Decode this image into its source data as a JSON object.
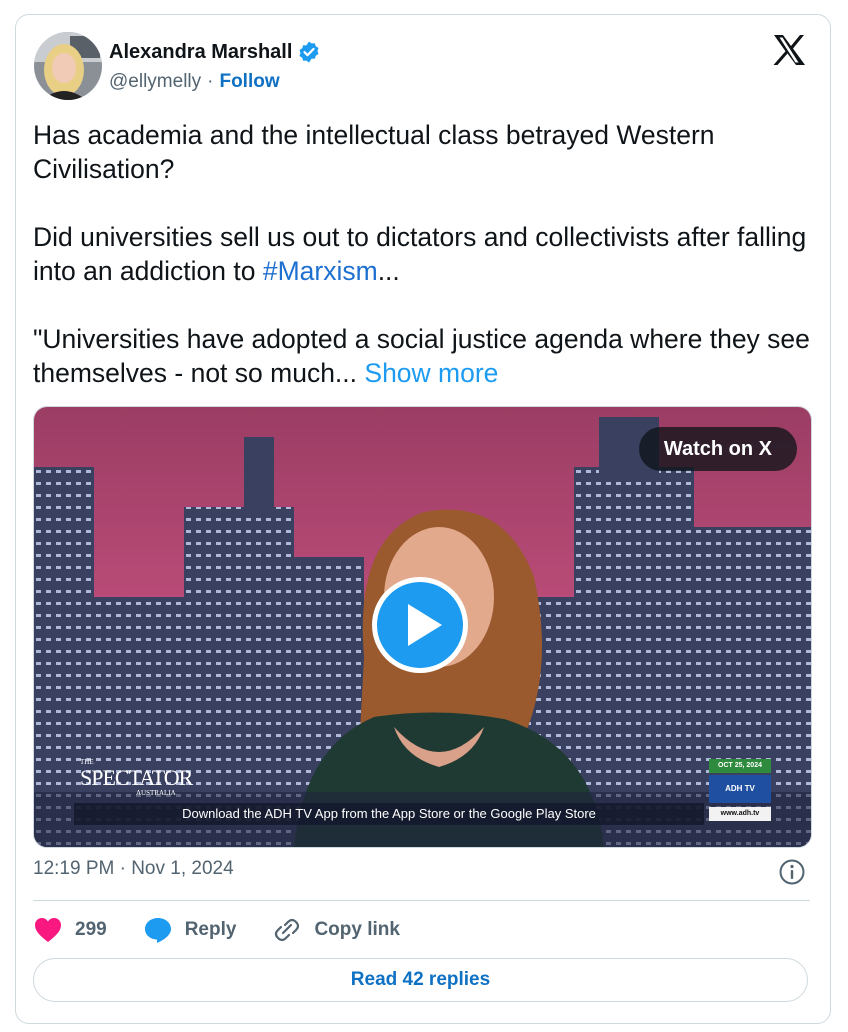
{
  "author": {
    "name": "Alexandra Marshall",
    "handle": "@ellymelly",
    "separator": "·",
    "follow_label": "Follow"
  },
  "tweet": {
    "paragraph1": "Has academia and the intellectual class betrayed Western Civilisation?",
    "paragraph2_pre": "Did universities sell us out to dictators and collectivists after falling into an addiction to ",
    "hashtag": "#Marxism",
    "paragraph2_post": "...",
    "paragraph3": "\"Universities have adopted a social justice agenda where they see themselves - not so much... ",
    "show_more_label": "Show more"
  },
  "video": {
    "watch_label": "Watch on X",
    "spectator_top": "THE",
    "spectator_name": "SPECTATOR",
    "spectator_sub": "AUSTRALIA",
    "ticker_text": "Download the ADH TV App from the App Store or the Google Play Store",
    "adh_date": "OCT 25, 2024",
    "adh_logo": "ADH TV",
    "adh_url": "www.adh.tv"
  },
  "meta": {
    "timestamp": "12:19 PM · Nov 1, 2024"
  },
  "actions": {
    "like_count": "299",
    "reply_label": "Reply",
    "copy_label": "Copy link"
  },
  "read_replies_label": "Read 42 replies",
  "colors": {
    "accent": "#1d9bf0",
    "link": "#0f71c4",
    "like": "#f91880",
    "muted": "#536471",
    "border": "#cfd9de"
  },
  "icons": [
    "verified-badge-icon",
    "x-logo-icon",
    "play-icon",
    "info-icon",
    "heart-icon",
    "reply-bubble-icon",
    "link-icon"
  ]
}
